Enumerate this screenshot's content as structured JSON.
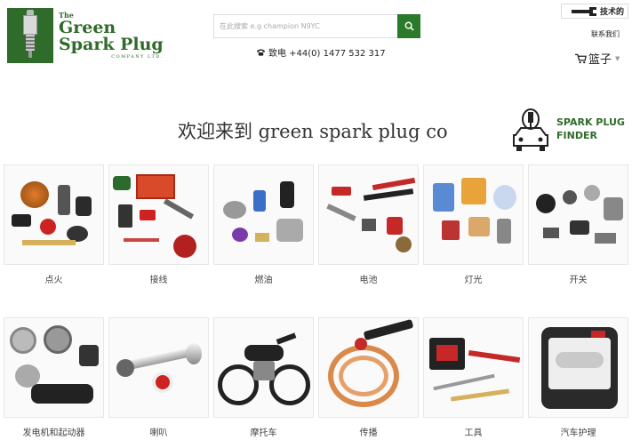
{
  "header": {
    "logo": {
      "the": "The",
      "line1": "Green",
      "line2": "Spark Plug",
      "company": "COMPANY LTD."
    },
    "search": {
      "placeholder": "在此搜索 e.g champion N9YC",
      "button_icon": "search-icon"
    },
    "phone": {
      "label": "致电 +44(0) 1477 532 317",
      "icon": "phone-icon"
    },
    "tech": {
      "label": "技术的",
      "icon": "wrench-icon"
    },
    "contact": "联系我们",
    "basket": {
      "label": "篮子",
      "icon": "cart-icon"
    }
  },
  "welcome": "欢迎来到 green spark plug co",
  "finder": {
    "line1": "SPARK PLUG",
    "line2": "FINDER",
    "icon": "car-plug-icon"
  },
  "categories": [
    {
      "label": "点火",
      "accent": "#c0392b"
    },
    {
      "label": "接线",
      "accent": "#d94a2b"
    },
    {
      "label": "燃油",
      "accent": "#3b6fc7"
    },
    {
      "label": "电池",
      "accent": "#c62828"
    },
    {
      "label": "灯光",
      "accent": "#e8a33a"
    },
    {
      "label": "开关",
      "accent": "#555555"
    },
    {
      "label": "发电机和起动器",
      "accent": "#777777"
    },
    {
      "label": "喇叭",
      "accent": "#cc2222"
    },
    {
      "label": "摩托车",
      "accent": "#222222"
    },
    {
      "label": "传播",
      "accent": "#d98a4a"
    },
    {
      "label": "工具",
      "accent": "#c62828"
    },
    {
      "label": "汽车护理",
      "accent": "#333333"
    }
  ],
  "colors": {
    "brand_green": "#2f6b2a",
    "search_button": "#2a7a2a"
  }
}
